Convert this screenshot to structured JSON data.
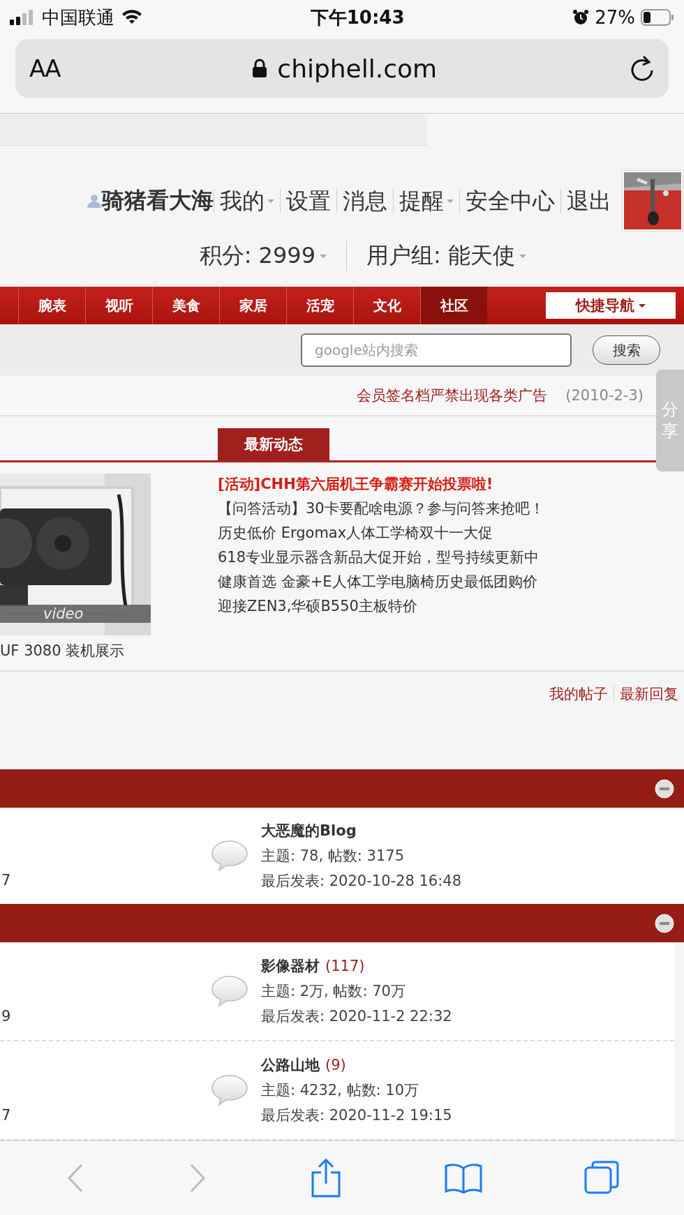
{
  "status_bar": {
    "carrier": "中国联通",
    "time": "下午10:43",
    "battery": "27%"
  },
  "browser": {
    "text_size": "AA",
    "url": "chiphell.com"
  },
  "user_bar": {
    "username": "骑猪看大海",
    "links": [
      {
        "label": "我的",
        "dropdown": true
      },
      {
        "label": "设置",
        "dropdown": false
      },
      {
        "label": "消息",
        "dropdown": false
      },
      {
        "label": "提醒",
        "dropdown": true
      },
      {
        "label": "安全中心",
        "dropdown": false
      },
      {
        "label": "退出",
        "dropdown": false
      }
    ]
  },
  "stats": [
    {
      "label": "积分: 2999",
      "dropdown": true
    },
    {
      "label": "用户组: 能天使",
      "dropdown": true
    }
  ],
  "nav": {
    "items": [
      {
        "label": "腕表",
        "selected": false
      },
      {
        "label": "视听",
        "selected": false
      },
      {
        "label": "美食",
        "selected": false
      },
      {
        "label": "家居",
        "selected": false
      },
      {
        "label": "活宠",
        "selected": false
      },
      {
        "label": "文化",
        "selected": false
      },
      {
        "label": "社区",
        "selected": true
      }
    ],
    "quick_nav": "快捷导航"
  },
  "search": {
    "placeholder": "google站内搜索",
    "button": "搜索"
  },
  "notice": {
    "text": "会员签名档严禁出现各类广告",
    "date": "(2010-2-3)"
  },
  "share_tab": "分享",
  "latest": {
    "tab": "最新动态",
    "featured": {
      "overlay": "video",
      "caption": "UF 3080 装机展示"
    },
    "links": [
      {
        "text": "[活动]CHH第六届机王争霸赛开始投票啦!",
        "highlighted": true
      },
      {
        "text": "【问答活动】30卡要配啥电源？参与问答来抢吧！",
        "highlighted": false
      },
      {
        "text": "历史低价 Ergomax人体工学椅双十一大促",
        "highlighted": false
      },
      {
        "text": "618专业显示器含新品大促开始，型号持续更新中",
        "highlighted": false
      },
      {
        "text": "健康首选 金豪+E人体工学电脑椅历史最低团购价",
        "highlighted": false
      },
      {
        "text": "迎接ZEN3,华硕B550主板特价",
        "highlighted": false
      }
    ]
  },
  "my_links": [
    "我的帖子",
    "最新回复"
  ],
  "categories": [
    {
      "expanded": true,
      "forums": [
        {
          "column_1": "7",
          "name": "大恶魔的Blog",
          "stats": "主题: 78, 帖数: 3175",
          "last_post": "最后发表: 2020-10-28 16:48"
        }
      ]
    },
    {
      "expanded": true,
      "forums": [
        {
          "column_1": "9",
          "name": "影像器材",
          "count": "(117)",
          "stats": "主题: 2万, 帖数: 70万",
          "last_post": "最后发表: 2020-11-2 22:32"
        },
        {
          "column_1": "7",
          "name": "公路山地",
          "count": "(9)",
          "stats": "主题: 4232, 帖数: 10万",
          "last_post": "最后发表: 2020-11-2 19:15"
        }
      ]
    }
  ],
  "toolbar": {
    "back_disabled": true,
    "forward_disabled": true
  }
}
